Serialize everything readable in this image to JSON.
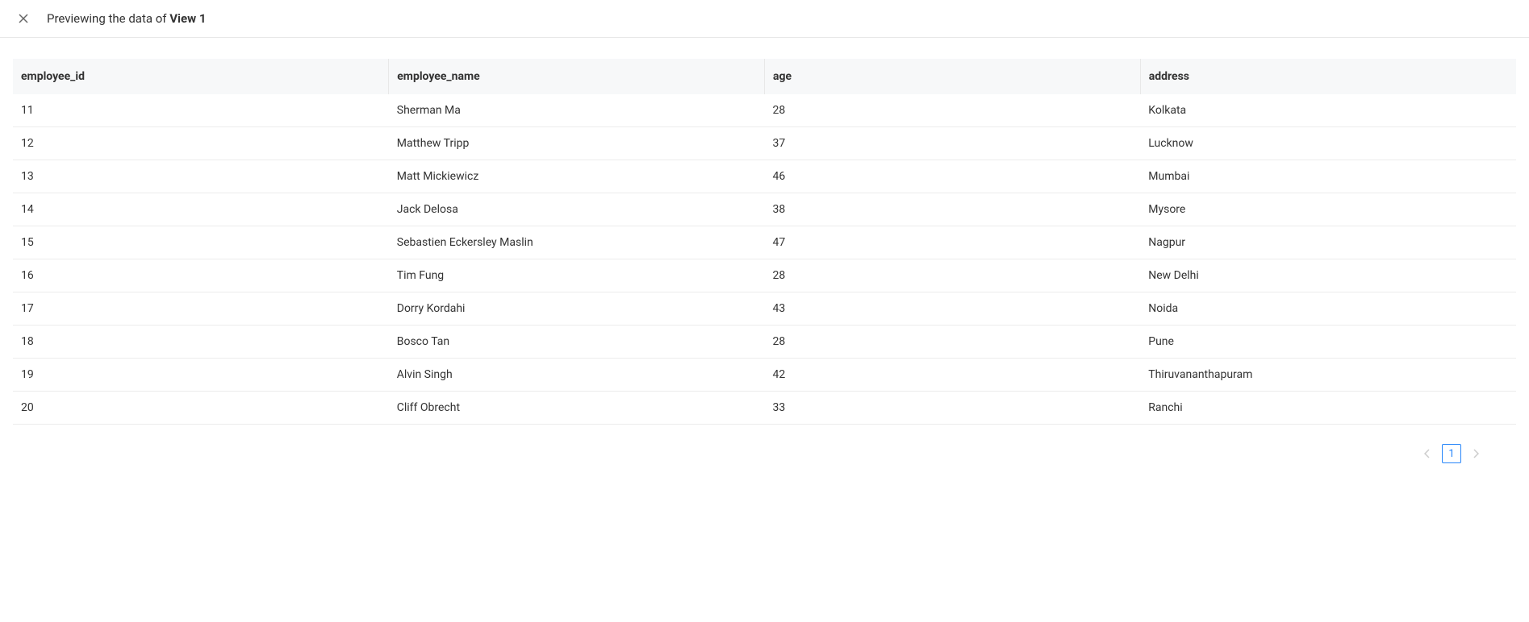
{
  "header": {
    "title_prefix": "Previewing the data of ",
    "view_name": "View 1"
  },
  "table": {
    "columns": [
      "employee_id",
      "employee_name",
      "age",
      "address"
    ],
    "rows": [
      {
        "employee_id": "11",
        "employee_name": "Sherman Ma",
        "age": "28",
        "address": "Kolkata"
      },
      {
        "employee_id": "12",
        "employee_name": "Matthew Tripp",
        "age": "37",
        "address": "Lucknow"
      },
      {
        "employee_id": "13",
        "employee_name": "Matt Mickiewicz",
        "age": "46",
        "address": "Mumbai"
      },
      {
        "employee_id": "14",
        "employee_name": "Jack Delosa",
        "age": "38",
        "address": "Mysore"
      },
      {
        "employee_id": "15",
        "employee_name": "Sebastien Eckersley Maslin",
        "age": "47",
        "address": "Nagpur"
      },
      {
        "employee_id": "16",
        "employee_name": "Tim Fung",
        "age": "28",
        "address": "New Delhi"
      },
      {
        "employee_id": "17",
        "employee_name": "Dorry Kordahi",
        "age": "43",
        "address": "Noida"
      },
      {
        "employee_id": "18",
        "employee_name": "Bosco Tan",
        "age": "28",
        "address": "Pune"
      },
      {
        "employee_id": "19",
        "employee_name": "Alvin Singh",
        "age": "42",
        "address": "Thiruvananthapuram"
      },
      {
        "employee_id": "20",
        "employee_name": "Cliff Obrecht",
        "age": "33",
        "address": "Ranchi"
      }
    ]
  },
  "pagination": {
    "current_page": "1"
  }
}
